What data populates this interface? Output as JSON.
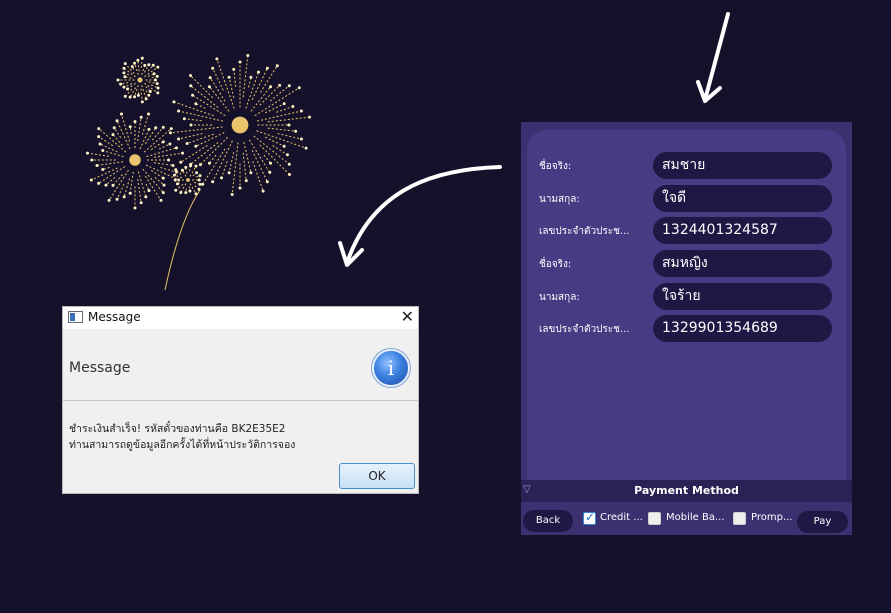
{
  "dialog": {
    "title": "Message",
    "heading": "Message",
    "info_icon": "i",
    "message_line1": "ชำระเงินสำเร็จ! รหัสตั๋วของท่านคือ BK2E35E2",
    "message_line2": "ท่านสามารถดูข้อมูลอีกครั้งได้ที่หน้าประวัติการจอง",
    "ok_label": "OK",
    "close_symbol": "✕"
  },
  "passengers": [
    {
      "first_label": "ชื่อจริง:",
      "first_value": "สมชาย",
      "last_label": "นามสกุล:",
      "last_value": "ใจดี",
      "id_label": "เลขประจำตัวประช...",
      "id_value": "1324401324587"
    },
    {
      "first_label": "ชื่อจริง:",
      "first_value": "สมหญิง",
      "last_label": "นามสกุล:",
      "last_value": "ใจร้าย",
      "id_label": "เลขประจำตัวประช...",
      "id_value": "1329901354689"
    }
  ],
  "payment": {
    "section_title": "Payment Method",
    "toggle_symbol": "▽",
    "back_label": "Back",
    "pay_label": "Pay",
    "options": [
      {
        "label": "Credit ...",
        "checked": true
      },
      {
        "label": "Mobile Ba...",
        "checked": false
      },
      {
        "label": "Promp...",
        "checked": false
      }
    ]
  },
  "colors": {
    "background": "#15112a",
    "panel": "#3c3170",
    "field": "#1f1845",
    "firework": "#e9c46a"
  },
  "icons": [
    "fireworks-decoration",
    "arrow-down-icon",
    "curved-arrow-icon",
    "info-icon",
    "window-icon",
    "close-icon",
    "checkbox-icon"
  ]
}
